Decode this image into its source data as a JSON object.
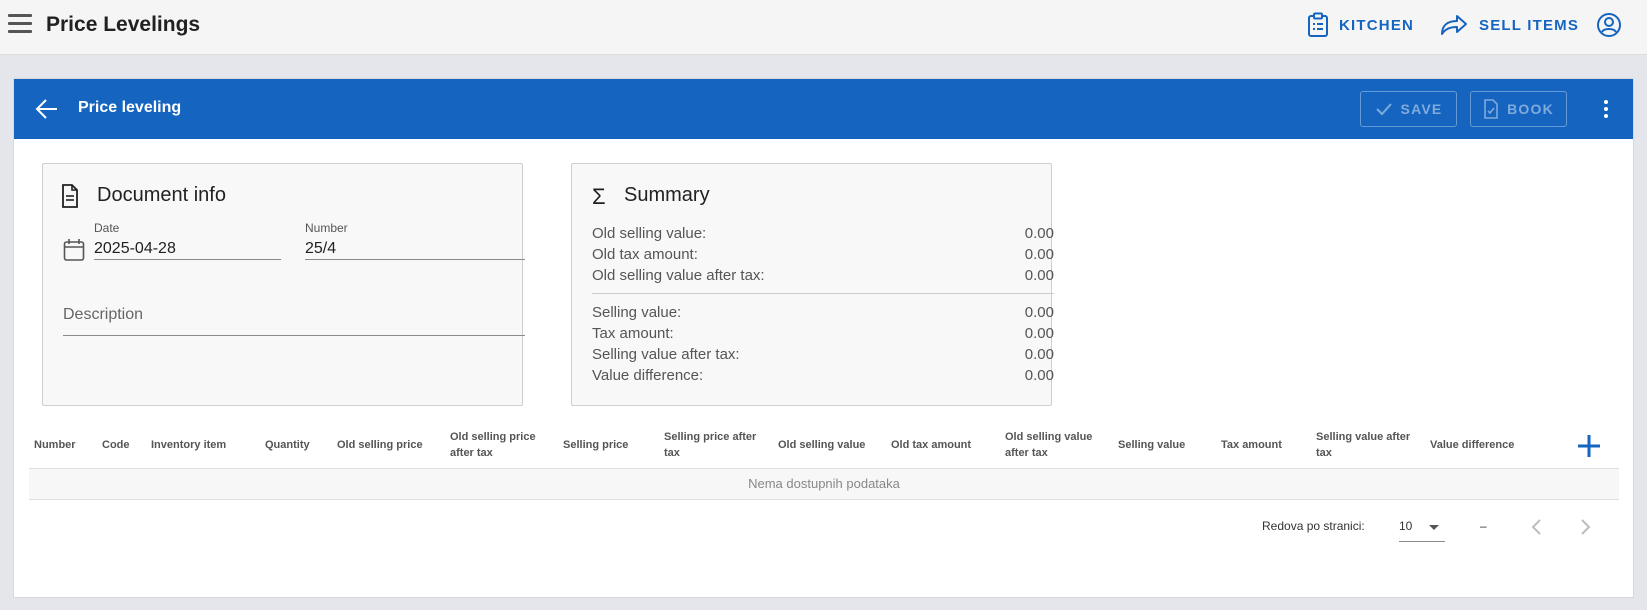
{
  "appbar": {
    "title": "Price Levelings",
    "kitchen_label": "KITCHEN",
    "sell_items_label": "SELL ITEMS"
  },
  "header": {
    "title": "Price leveling",
    "save_label": "SAVE",
    "book_label": "BOOK"
  },
  "document_info": {
    "title": "Document info",
    "date_label": "Date",
    "date_value": "2025-04-28",
    "number_label": "Number",
    "number_value": "25/4",
    "description_label": "Description"
  },
  "summary": {
    "title": "Summary",
    "rows_top": [
      {
        "label": "Old selling value:",
        "value": "0.00"
      },
      {
        "label": "Old tax amount:",
        "value": "0.00"
      },
      {
        "label": "Old selling value after tax:",
        "value": "0.00"
      }
    ],
    "rows_bottom": [
      {
        "label": "Selling value:",
        "value": "0.00"
      },
      {
        "label": "Tax amount:",
        "value": "0.00"
      },
      {
        "label": "Selling value after tax:",
        "value": "0.00"
      },
      {
        "label": "Value difference:",
        "value": "0.00"
      }
    ]
  },
  "table": {
    "columns": [
      "Number",
      "Code",
      "Inventory item",
      "Quantity",
      "Old selling price",
      "Old selling price after tax",
      "Selling price",
      "Selling price after tax",
      "Old selling value",
      "Old tax amount",
      "Old selling value after tax",
      "Selling value",
      "Tax amount",
      "Selling value after tax",
      "Value difference"
    ],
    "empty_text": "Nema dostupnih podataka"
  },
  "pagination": {
    "rows_per_page_label": "Redova po stranici:",
    "rows_per_page_value": "10",
    "range_text": "–"
  },
  "colors": {
    "primary": "#1565c0",
    "appbar_bg": "#f5f5f5",
    "page_bg": "#e4e6ec"
  }
}
